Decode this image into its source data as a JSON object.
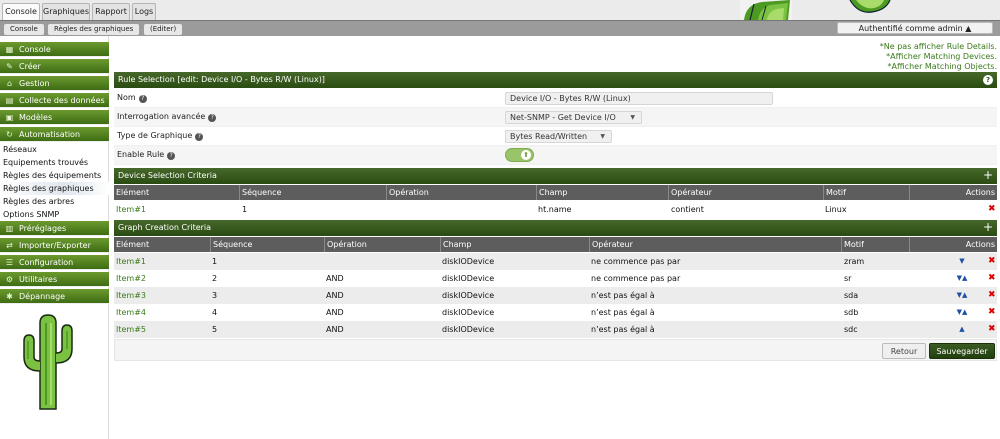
{
  "tabs": [
    {
      "label": "Console"
    },
    {
      "label": "Graphiques"
    },
    {
      "label": "Rapport"
    },
    {
      "label": "Logs"
    }
  ],
  "breadcrumbs": [
    {
      "label": "Console"
    },
    {
      "label": "Règles des graphiques"
    },
    {
      "label": "(Editer)"
    }
  ],
  "auth": {
    "label": "Authentifié comme admin ▲"
  },
  "sidebar": {
    "sections": [
      {
        "label": "Console",
        "icon": "map-icon"
      },
      {
        "label": "Créer",
        "icon": "pencil-icon"
      },
      {
        "label": "Gestion",
        "icon": "home-icon"
      },
      {
        "label": "Collecte des données",
        "icon": "database-icon"
      },
      {
        "label": "Modèles",
        "icon": "template-icon"
      },
      {
        "label": "Automatisation",
        "icon": "refresh-icon"
      }
    ],
    "items": [
      {
        "label": "Réseaux"
      },
      {
        "label": "Equipements trouvés"
      },
      {
        "label": "Règles des équipements"
      },
      {
        "label": "Règles des graphiques"
      },
      {
        "label": "Règles des arbres"
      },
      {
        "label": "Options SNMP"
      }
    ],
    "sections2": [
      {
        "label": "Préréglages",
        "icon": "preset-icon"
      },
      {
        "label": "Importer/Exporter",
        "icon": "exchange-icon"
      },
      {
        "label": "Configuration",
        "icon": "sliders-icon"
      },
      {
        "label": "Utilitaires",
        "icon": "gears-icon"
      },
      {
        "label": "Dépannage",
        "icon": "bug-icon"
      }
    ]
  },
  "notes": [
    "*Ne pas afficher Rule Details.",
    "*Afficher Matching Devices.",
    "*Afficher Matching Objects."
  ],
  "rule_section": {
    "title": "Rule Selection [edit: Device I/O - Bytes R/W (Linux)]",
    "help": "?",
    "fields": {
      "name_label": "Nom",
      "name_value": "Device I/O - Bytes R/W (Linux)",
      "query_label": "Interrogation avancée",
      "query_value": "Net-SNMP - Get Device I/O",
      "graph_type_label": "Type de Graphique",
      "graph_type_value": "Bytes Read/Written",
      "enable_label": "Enable Rule",
      "enable_value": true
    }
  },
  "device_criteria": {
    "title": "Device Selection Criteria",
    "add": "+",
    "columns": [
      "Elément",
      "Séquence",
      "Opération",
      "Champ",
      "Opérateur",
      "Motif",
      "Actions"
    ],
    "rows": [
      {
        "item": "Item#1",
        "seq": "1",
        "op": "",
        "field": "ht.name",
        "operator": "contient",
        "pattern": "Linux"
      }
    ]
  },
  "graph_criteria": {
    "title": "Graph Creation Criteria",
    "add": "+",
    "columns": [
      "Elément",
      "Séquence",
      "Opération",
      "Champ",
      "Opérateur",
      "Motif",
      "Actions"
    ],
    "rows": [
      {
        "item": "Item#1",
        "seq": "1",
        "op": "",
        "field": "diskIODevice",
        "operator": "ne commence pas par",
        "pattern": "zram",
        "arrows": "▼"
      },
      {
        "item": "Item#2",
        "seq": "2",
        "op": "AND",
        "field": "diskIODevice",
        "operator": "ne commence pas par",
        "pattern": "sr",
        "arrows": "▼▲"
      },
      {
        "item": "Item#3",
        "seq": "3",
        "op": "AND",
        "field": "diskIODevice",
        "operator": "n’est pas égal à",
        "pattern": "sda",
        "arrows": "▼▲"
      },
      {
        "item": "Item#4",
        "seq": "4",
        "op": "AND",
        "field": "diskIODevice",
        "operator": "n’est pas égal à",
        "pattern": "sdb",
        "arrows": "▼▲"
      },
      {
        "item": "Item#5",
        "seq": "5",
        "op": "AND",
        "field": "diskIODevice",
        "operator": "n’est pas égal à",
        "pattern": "sdc",
        "arrows": "▲"
      }
    ]
  },
  "buttons": {
    "back": "Retour",
    "save": "Sauvegarder"
  },
  "colors": {
    "accent": "#3e6c14",
    "link": "#3a7a1a",
    "delete": "#dd0000"
  }
}
